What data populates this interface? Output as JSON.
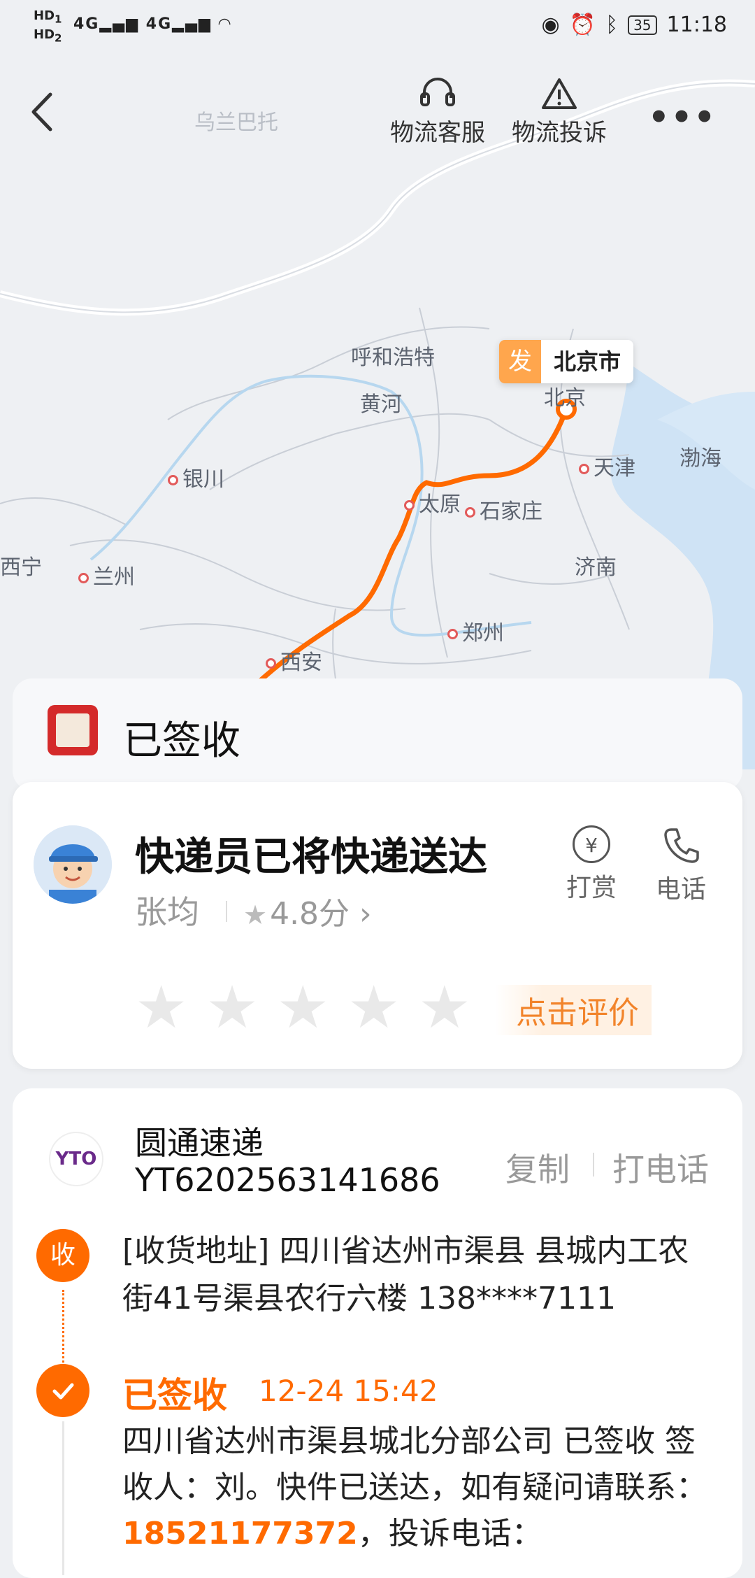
{
  "status_bar": {
    "left_labels": [
      "HD",
      "HD"
    ],
    "sim_labels": [
      "1",
      "2"
    ],
    "signal_1": "4G",
    "signal_2": "4G",
    "battery": "35",
    "time": "11:18"
  },
  "top_nav": {
    "service_label": "物流客服",
    "complaint_label": "物流投诉"
  },
  "map": {
    "cities": {
      "ulanbator": "乌兰巴托",
      "hohhot": "呼和浩特",
      "yellow_river": "黄河",
      "beijing_small": "北京",
      "tianjin": "天津",
      "bohai": "渤海",
      "yinchuan": "银川",
      "taiyuan": "太原",
      "shijiazhuang": "石家庄",
      "xining": "西宁",
      "lanzhou": "兰州",
      "jinan": "济南",
      "zhengzhou": "郑州",
      "xian": "西安"
    },
    "origin_tag": "发",
    "origin_name": "北京市",
    "route_color": "#ff6a00"
  },
  "status_card": {
    "title": "已签收"
  },
  "courier_card": {
    "message": "快递员已将快递送达",
    "courier_name": "张均",
    "rating": "4.8分",
    "tip_label": "打赏",
    "tip_symbol": "¥",
    "phone_label": "电话",
    "eval_cta": "点击评价",
    "stars_filled": 0,
    "stars_total": 5
  },
  "tracking_card": {
    "carrier_logo_text": "YTO",
    "carrier_name": "圆通速递",
    "tracking_number": "YT6202563141686",
    "copy_label": "复制",
    "call_label": "打电话",
    "receive_tag": "收",
    "address": "[收货地址] 四川省达州市渠县   县城内工农街41号渠县农行六楼 138****7111",
    "event_title": "已签收",
    "event_time": "12-24 15:42",
    "event_desc_prefix": "四川省达州市渠县城北分部公司 已签收 签收人：刘。快件已送达，如有疑问请联系：",
    "event_phone": "18521177372",
    "event_desc_suffix": "，投诉电话："
  },
  "colors": {
    "accent": "#ff6a00",
    "origin_tag_bg": "#ffa64d",
    "eval_cta": "#f2842b"
  }
}
